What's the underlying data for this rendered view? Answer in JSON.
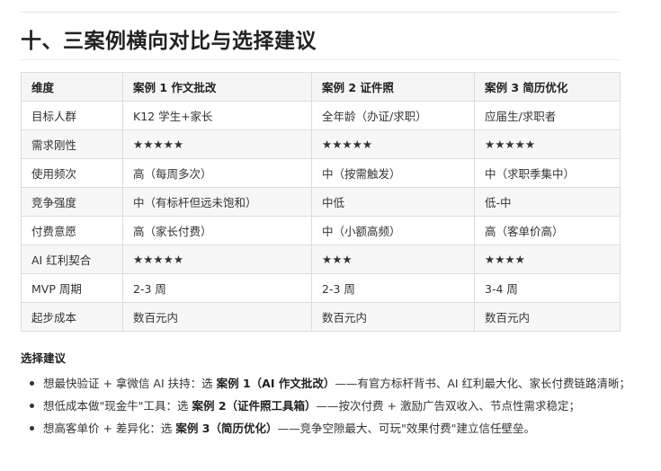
{
  "heading": "十、三案例横向对比与选择建议",
  "table": {
    "headers": [
      "维度",
      "案例 1 作文批改",
      "案例 2 证件照",
      "案例 3 简历优化"
    ],
    "rows": [
      [
        "目标人群",
        "K12 学生+家长",
        "全年龄（办证/求职）",
        "应届生/求职者"
      ],
      [
        "需求刚性",
        "★★★★★",
        "★★★★★",
        "★★★★★"
      ],
      [
        "使用频次",
        "高（每周多次）",
        "中（按需触发）",
        "中（求职季集中）"
      ],
      [
        "竞争强度",
        "中（有标杆但远未饱和）",
        "中低",
        "低-中"
      ],
      [
        "付费意愿",
        "高（家长付费）",
        "中（小额高频）",
        "高（客单价高）"
      ],
      [
        "AI 红利契合",
        "★★★★★",
        "★★★",
        "★★★★"
      ],
      [
        "MVP 周期",
        "2-3 周",
        "2-3 周",
        "3-4 周"
      ],
      [
        "起步成本",
        "数百元内",
        "数百元内",
        "数百元内"
      ]
    ]
  },
  "suggestions": {
    "title": "选择建议",
    "items": [
      {
        "pre": "想最快验证 + 拿微信 AI 扶持：选 ",
        "bold": "案例 1（AI 作文批改）",
        "post": "——有官方标杆背书、AI 红利最大化、家长付费链路清晰；"
      },
      {
        "pre": "想低成本做\"现金牛\"工具：选 ",
        "bold": "案例 2（证件照工具箱）",
        "post": "——按次付费 + 激励广告双收入、节点性需求稳定；"
      },
      {
        "pre": "想高客单价 + 差异化：选 ",
        "bold": "案例 3（简历优化）",
        "post": "——竞争空隙最大、可玩\"效果付费\"建立信任壁垒。"
      }
    ]
  }
}
